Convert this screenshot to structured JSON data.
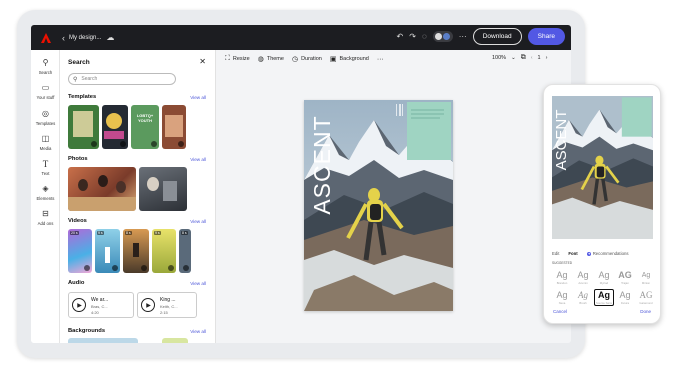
{
  "topbar": {
    "title": "My design...",
    "download_label": "Download",
    "share_label": "Share",
    "colors": {
      "bar": "#1c1d21",
      "share": "#5258e4",
      "logo": "#eb1000"
    }
  },
  "rail": {
    "items": [
      {
        "label": "Search",
        "icon": "search-icon"
      },
      {
        "label": "Your stuff",
        "icon": "folder-icon"
      },
      {
        "label": "Templates",
        "icon": "templates-icon"
      },
      {
        "label": "Media",
        "icon": "media-icon"
      },
      {
        "label": "Text",
        "icon": "text-icon"
      },
      {
        "label": "Elements",
        "icon": "elements-icon"
      },
      {
        "label": "Add ons",
        "icon": "addons-icon"
      }
    ]
  },
  "panel": {
    "heading": "Search",
    "search_placeholder": "Search",
    "sections": {
      "templates": {
        "title": "Templates",
        "view_all": "View all"
      },
      "photos": {
        "title": "Photos",
        "view_all": "View all"
      },
      "videos": {
        "title": "Videos",
        "view_all": "View all",
        "durations": [
          "20 s",
          "9 s",
          "8 s",
          "9 s",
          "8 s"
        ]
      },
      "audio": {
        "title": "Audio",
        "view_all": "View all"
      },
      "backgrounds": {
        "title": "Backgrounds",
        "view_all": "View all"
      }
    },
    "template_texts": [
      "LGBTQ+ YOUTH"
    ],
    "audio": [
      {
        "title": "We ar...",
        "sub": "Bras, C...",
        "dur": "4:20"
      },
      {
        "title": "King ...",
        "sub": "Keith, C...",
        "dur": "2:15"
      }
    ]
  },
  "editor": {
    "tools": [
      {
        "label": "Resize",
        "icon": "resize-icon"
      },
      {
        "label": "Theme",
        "icon": "theme-icon"
      },
      {
        "label": "Duration",
        "icon": "clock-icon"
      },
      {
        "label": "Background",
        "icon": "background-icon"
      }
    ],
    "zoom": "100%",
    "page": "1"
  },
  "design": {
    "heading": "ASCENT",
    "accent": "#9fd4c2"
  },
  "phone": {
    "tabs": {
      "edit": "Edit",
      "font": "Font",
      "recs": "Recommendations"
    },
    "section": "SUGGESTED",
    "fonts": [
      {
        "glyph": "Ag",
        "name": "Brandon"
      },
      {
        "glyph": "Ag",
        "name": "Acumin"
      },
      {
        "glyph": "Ag",
        "name": "Myriad"
      },
      {
        "glyph": "AG",
        "name": "Trajan"
      },
      {
        "glyph": "Ag",
        "name": "Minion"
      },
      {
        "glyph": "Ag",
        "name": "Nexa"
      },
      {
        "glyph": "Ag",
        "name": "Brush"
      },
      {
        "glyph": "Ag",
        "name": "Source Sans"
      },
      {
        "glyph": "Ag",
        "name": "Futura"
      },
      {
        "glyph": "AG",
        "name": "Garamond"
      }
    ],
    "cancel": "Cancel",
    "done": "Done"
  }
}
